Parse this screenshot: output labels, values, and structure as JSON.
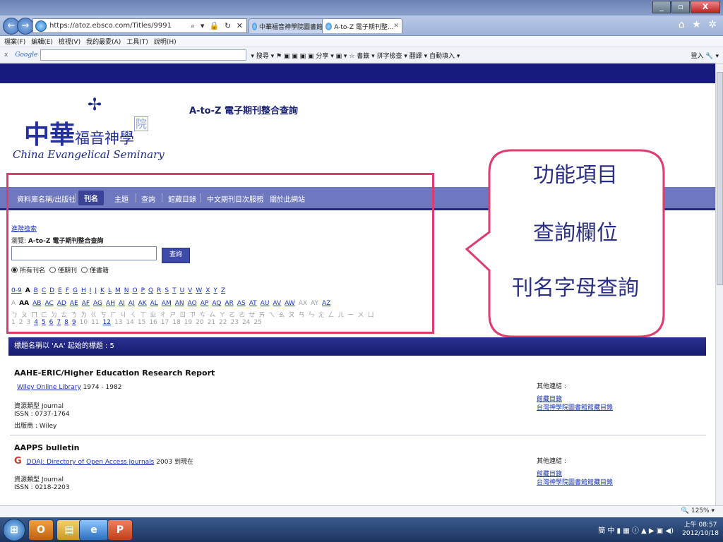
{
  "browser": {
    "address": "https://atoz.ebsco.com/Titles/9991",
    "address_icons": "⌕ ▾ 🔒 ↻ ✕",
    "tabs": [
      {
        "label": "中華福音神學院圖書館"
      },
      {
        "label": "A-to-Z 電子期刊整..."
      }
    ],
    "tab_close": "✕",
    "window_buttons": {
      "minimize": "_",
      "maximize": "▫",
      "close": "X"
    },
    "right_icons": "⌂ ★ ✲",
    "back": "←",
    "forward": "→"
  },
  "menu": [
    "檔案(F)",
    "編輯(E)",
    "檢視(V)",
    "我的最愛(A)",
    "工具(T)",
    "說明(H)"
  ],
  "google_bar": {
    "close": "x",
    "logo": "Google",
    "tools": "▾ 搜尋 ▾  ⚑  ▣ ▣ ▣ ▣ 分享 ▾ ▣ ▾ ☆ 書籤 ▾  拼字檢查 ▾  翻譯 ▾  自動填入 ▾",
    "sign_in": "登入 🔧 ▾"
  },
  "site": {
    "logo": {
      "cross": "✢",
      "zh_big": "中華",
      "zh_mid": "福音神學",
      "zh_small": "院",
      "en": "China Evangelical Seminary"
    },
    "title": "A-to-Z 電子期刊整合查詢",
    "nav": [
      "資料庫名稱/出版社",
      "刊名",
      "主題",
      "查詢",
      "館藏目錄",
      "中文期刊目次服務",
      "關於此網站"
    ],
    "advanced_search": "進階檢索",
    "browse_prefix": "瀏覽:",
    "browse_name": "A-to-Z 電子期刊整合查詢",
    "search_button": "查詢",
    "radio_options": [
      "所有刊名",
      "僅期刊",
      "僅書籍"
    ],
    "alpha_row1": [
      "0-9",
      "A",
      "B",
      "C",
      "D",
      "E",
      "F",
      "G",
      "H",
      "I",
      "J",
      "K",
      "L",
      "M",
      "N",
      "O",
      "P",
      "Q",
      "R",
      "S",
      "T",
      "U",
      "V",
      "W",
      "X",
      "Y",
      "Z"
    ],
    "alpha_row2": [
      "A",
      "AA",
      "AB",
      "AC",
      "AD",
      "AE",
      "AF",
      "AG",
      "AH",
      "AI",
      "AJ",
      "AK",
      "AL",
      "AM",
      "AN",
      "AO",
      "AP",
      "AQ",
      "AR",
      "AS",
      "AT",
      "AU",
      "AV",
      "AW",
      "AX",
      "AY",
      "AZ"
    ],
    "alpha_row3": [
      "ㄅ",
      "ㄆ",
      "ㄇ",
      "ㄈ",
      "ㄉ",
      "ㄊ",
      "ㄋ",
      "ㄌ",
      "ㄍ",
      "ㄎ",
      "ㄏ",
      "ㄐ",
      "ㄑ",
      "ㄒ",
      "ㄓ",
      "ㄔ",
      "ㄕ",
      "ㄖ",
      "ㄗ",
      "ㄘ",
      "ㄙ",
      "ㄚ",
      "ㄛ",
      "ㄜ",
      "ㄝ",
      "ㄞ",
      "ㄟ",
      "ㄠ",
      "ㄡ",
      "ㄢ",
      "ㄣ",
      "ㄤ",
      "ㄥ",
      "ㄦ",
      "ㄧ",
      "ㄨ",
      "ㄩ"
    ],
    "alpha_row4": [
      "1",
      "2",
      "3",
      "4",
      "5",
      "6",
      "7",
      "8",
      "9",
      "10",
      "11",
      "12",
      "13",
      "14",
      "15",
      "16",
      "17",
      "18",
      "19",
      "20",
      "21",
      "22",
      "23",
      "24",
      "25"
    ]
  },
  "callout": {
    "labels": [
      "功能項目",
      "查詢欄位",
      "刊名字母查詢"
    ]
  },
  "results": {
    "header": "標題名稱以 'AA' 起始的標題 : 5",
    "items": [
      {
        "title": "AAHE-ERIC/Higher Education Research Report",
        "source": "Wiley Online Library",
        "coverage": "1974 - 1982",
        "type": "資源類型 Journal",
        "issn": "ISSN : 0737-1764",
        "publisher": "出版商 : Wiley",
        "other_label": "其他連結 :",
        "other_links": [
          "館藏目錄",
          "台灣神學院圖書館館藏目錄"
        ]
      },
      {
        "title": "AAPPS bulletin",
        "source_icon": "G",
        "source": "DOAJ: Directory of Open Access Journals",
        "coverage": "2003 到現在",
        "type": "資源類型 Journal",
        "issn": "ISSN : 0218-2203",
        "other_label": "其他連結 :",
        "other_links": [
          "館藏目錄",
          "台灣神學院圖書館館藏目錄"
        ]
      }
    ]
  },
  "status": {
    "zoom": "🔍 125%  ▾"
  },
  "taskbar": {
    "start": "⊞",
    "apps": [
      "O",
      "▤",
      "e",
      "P"
    ],
    "tray": "簡 中 ▮ ▦ ⓘ ▲ ▶ ▣ ◀)",
    "time": "上午 08:57",
    "date": "2012/10/18"
  }
}
